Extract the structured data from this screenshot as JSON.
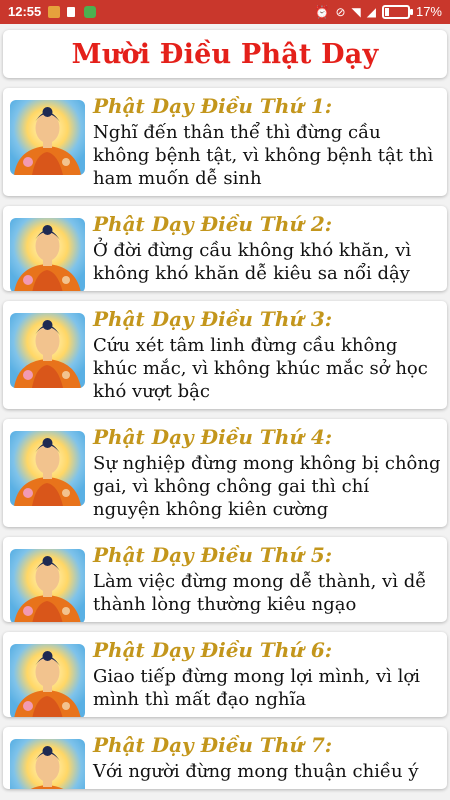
{
  "status_bar": {
    "time": "12:55",
    "battery_percent": "17%",
    "battery_level": 0.17,
    "icons": [
      "message-icon",
      "sim-icon",
      "android-icon",
      "alarm-icon",
      "no-sim-icon",
      "wifi-icon",
      "signal-icon",
      "battery-icon"
    ]
  },
  "header": {
    "title": "Mười Điều Phật Dạy"
  },
  "colors": {
    "status_bar": "#c9372c",
    "title": "#e4201a",
    "item_title": "#c3961c"
  },
  "items": [
    {
      "title": "Phật Dạy Điều Thứ 1:",
      "body": "Nghĩ đến thân thể thì đừng cầu không bệnh tật, vì không bệnh tật thì ham muốn dễ sinh"
    },
    {
      "title": "Phật Dạy Điều Thứ 2:",
      "body": "Ở đời đừng cầu không khó khăn, vì không khó khăn dễ kiêu sa nổi dậy"
    },
    {
      "title": "Phật Dạy Điều Thứ 3:",
      "body": "Cứu xét tâm linh đừng cầu không khúc mắc, vì không khúc mắc sở học khó vượt bậc"
    },
    {
      "title": "Phật Dạy Điều Thứ 4:",
      "body": "Sự nghiệp đừng mong không bị chông gai, vì không chông gai thì chí nguyện không kiên cường"
    },
    {
      "title": "Phật Dạy Điều Thứ 5:",
      "body": "Làm việc đừng mong dễ thành, vì dễ thành lòng thường kiêu ngạo"
    },
    {
      "title": "Phật Dạy Điều Thứ 6:",
      "body": "Giao tiếp đừng mong lợi mình, vì lợi mình thì mất đạo nghĩa"
    },
    {
      "title": "Phật Dạy Điều Thứ 7:",
      "body": "Với người đừng mong thuận chiều ý"
    }
  ]
}
